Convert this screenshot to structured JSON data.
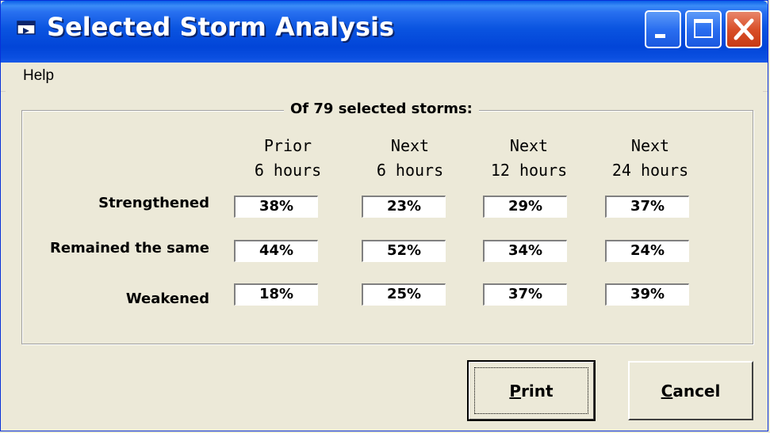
{
  "window": {
    "title": "Selected Storm Analysis",
    "icon": "app-window-icon",
    "controls": [
      "minimize-icon",
      "maximize-icon",
      "close-icon"
    ]
  },
  "menu": {
    "items": [
      {
        "label": "Help"
      }
    ]
  },
  "group": {
    "caption": "Of 79 selected storms:"
  },
  "columns": [
    {
      "line1": "Prior",
      "line2": "6 hours"
    },
    {
      "line1": "Next",
      "line2": "6 hours"
    },
    {
      "line1": "Next",
      "line2": "12 hours"
    },
    {
      "line1": "Next",
      "line2": "24 hours"
    }
  ],
  "rows": [
    {
      "label": "Strengthened",
      "values": [
        "38%",
        "23%",
        "29%",
        "37%"
      ]
    },
    {
      "label": "Remained the same",
      "values": [
        "44%",
        "52%",
        "34%",
        "24%"
      ]
    },
    {
      "label": "Weakened",
      "values": [
        "18%",
        "25%",
        "37%",
        "39%"
      ]
    }
  ],
  "buttons": {
    "print": {
      "mnemonic": "P",
      "rest": "rint"
    },
    "cancel": {
      "mnemonic": "C",
      "rest": "ancel"
    }
  },
  "colors": {
    "titlebar": "#0245d8",
    "face": "#ece9d8",
    "close": "#d9502a"
  }
}
